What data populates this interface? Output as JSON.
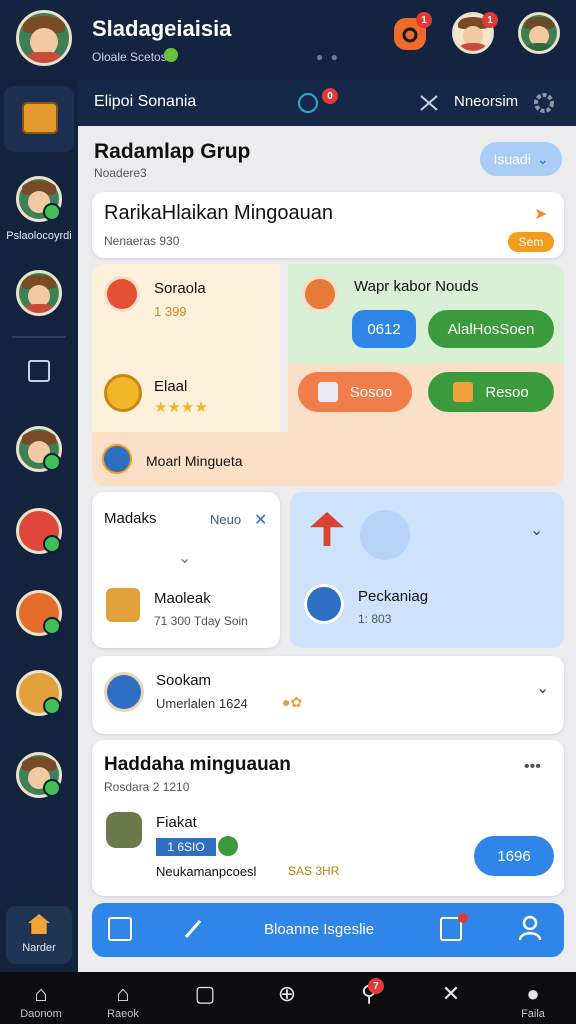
{
  "topbar": {
    "title": "Sladageiaisia",
    "subtitle": "Oloale Scetos",
    "badges": {
      "notifications": "1",
      "profile": "1"
    }
  },
  "subheader": {
    "left_label": "Elipoi Sonania",
    "badge": "0",
    "right_label": "Nneorsim"
  },
  "sidebar": {
    "items": [
      {
        "label": "Pslaolocoyrdi"
      },
      {
        "label": ""
      },
      {
        "label": "Narder"
      }
    ]
  },
  "group_header": {
    "title": "Radamlap Grup",
    "subtitle": "Noadere3",
    "action_label": "Isuadi"
  },
  "banner": {
    "title": "RarikaHlaikan Mingoauan",
    "subtitle": "Nenaeras 930",
    "tag": "Sem"
  },
  "panel_a": {
    "item1_name": "Soraola",
    "item1_value": "1 399",
    "item2_name": "Elaal",
    "rating_stars": "★★★★",
    "footer": "Moarl Mingueta"
  },
  "panel_b": {
    "title": "Wapr kabor Nouds",
    "btn_left": "0612",
    "btn_right": "AlalHosSoen",
    "btn_orange": "Sosoo",
    "btn_green": "Resoo"
  },
  "card_left": {
    "title": "Madaks",
    "action": "Neuo",
    "item_name": "Maoleak",
    "item_meta": "71 300  Tday Soin"
  },
  "card_right": {
    "item_name": "Peckaniag",
    "item_meta": "1: 803"
  },
  "row_sookam": {
    "name": "Sookam",
    "meta": "Umerlalen 1624"
  },
  "card_bottom": {
    "title": "Haddaha minguauan",
    "subtitle": "Rosdara 2 1210",
    "item_name": "Fiakat",
    "progress_label": "1 6SIO",
    "meta": "Neukamanpcoesl",
    "meta_value": "SAS 3HR",
    "pill": "1696"
  },
  "bottom_action": {
    "label": "Bloanne Isgeslie"
  },
  "tabbar": {
    "tabs": [
      {
        "label": "Daonom",
        "icon": "home-outline-icon"
      },
      {
        "label": "Raeok",
        "icon": "home-icon"
      },
      {
        "label": "",
        "icon": "square-icon"
      },
      {
        "label": "",
        "icon": "plus-circle-icon"
      },
      {
        "label": "",
        "icon": "search-icon",
        "badge": "7"
      },
      {
        "label": "",
        "icon": "cross-tools-icon"
      },
      {
        "label": "Faila",
        "icon": "user-icon"
      }
    ]
  },
  "colors": {
    "primary_blue": "#2f86e8",
    "green": "#3a9a3c",
    "orange": "#f07d4a",
    "dark_navy": "#132340"
  }
}
